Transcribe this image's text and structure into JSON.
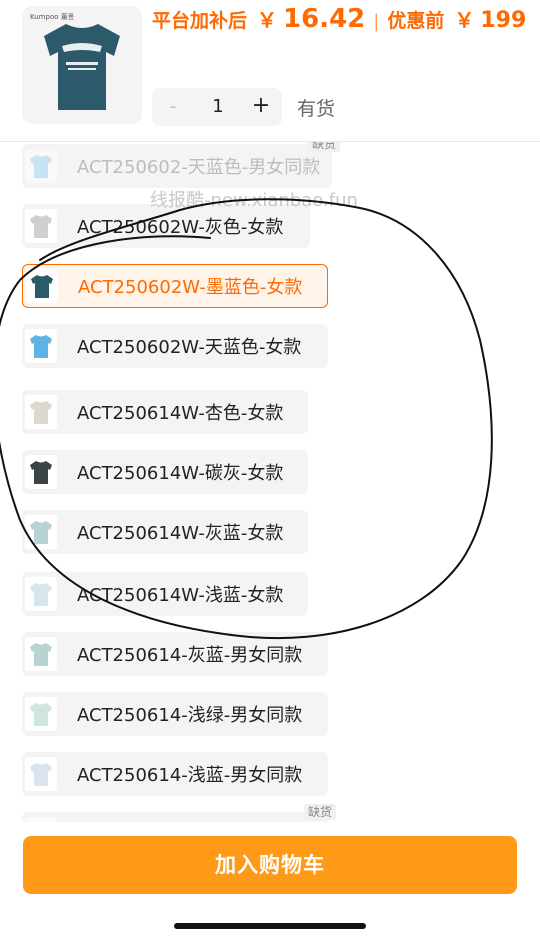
{
  "header": {
    "brand_mark": "Kumpoo 薰풍",
    "price_label": "平台加补后",
    "currency": "￥",
    "price": "16.42",
    "separator": "|",
    "original_label": "优惠前",
    "original_price": "199",
    "quantity": "1",
    "minus": "-",
    "plus": "+",
    "stock_status": "有货"
  },
  "watermark": "线报酷-new.xianbao.fun",
  "variants": [
    {
      "label": "ACT250602-天蓝色-男女同款",
      "state": "disabled",
      "color": "#9dd3f0",
      "tag": "缺货"
    },
    {
      "label": "ACT250602W-灰色-女款",
      "state": "normal",
      "color": "#cfcfcf"
    },
    {
      "label": "ACT250602W-墨蓝色-女款",
      "state": "selected",
      "color": "#2d5a6b"
    },
    {
      "label": "ACT250602W-天蓝色-女款",
      "state": "normal",
      "color": "#5fb3e2"
    },
    {
      "label": "ACT250614W-杏色-女款",
      "state": "normal",
      "color": "#dcd8cb"
    },
    {
      "label": "ACT250614W-碳灰-女款",
      "state": "normal",
      "color": "#3d4446"
    },
    {
      "label": "ACT250614W-灰蓝-女款",
      "state": "normal",
      "color": "#b8d4d2"
    },
    {
      "label": "ACT250614W-浅蓝-女款",
      "state": "normal",
      "color": "#d7e6ee"
    },
    {
      "label": "ACT250614-灰蓝-男女同款",
      "state": "normal",
      "color": "#b8d4d2"
    },
    {
      "label": "ACT250614-浅绿-男女同款",
      "state": "normal",
      "color": "#cfe6dd"
    },
    {
      "label": "ACT250614-浅蓝-男女同款",
      "state": "normal",
      "color": "#d9e4ee"
    },
    {
      "label": "",
      "state": "disabled",
      "color": "#e6e6e6",
      "tag": "缺货"
    }
  ],
  "cart_button": "加入购物车",
  "colors": {
    "accent": "#ff6a00",
    "button": "#ff9a18"
  }
}
